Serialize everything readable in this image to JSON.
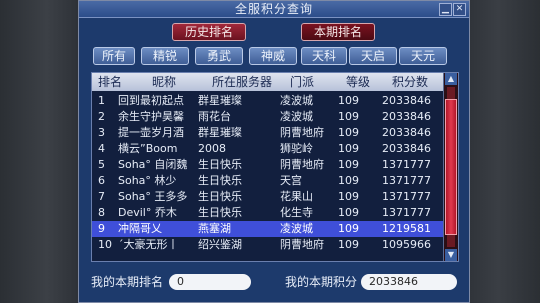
{
  "window": {
    "title": "全服积分查询"
  },
  "tabs": [
    {
      "label": "历史排名"
    },
    {
      "label": "本期排名"
    }
  ],
  "filters": [
    {
      "label": "所有"
    },
    {
      "label": "精锐"
    },
    {
      "label": "勇武"
    },
    {
      "label": "神威"
    },
    {
      "label": "天科"
    },
    {
      "label": "天启"
    },
    {
      "label": "天元"
    }
  ],
  "table": {
    "headers": [
      "排名",
      "昵称",
      "所在服务器",
      "门派",
      "等级",
      "积分数"
    ],
    "rows": [
      {
        "rank": "1",
        "name": "回到最初起点",
        "server": "群星璀璨",
        "sect": "凌波城",
        "level": "109",
        "score": "2033846"
      },
      {
        "rank": "2",
        "name": "余生守护昊馨",
        "server": "雨花台",
        "sect": "凌波城",
        "level": "109",
        "score": "2033846"
      },
      {
        "rank": "3",
        "name": "提一壶岁月酒",
        "server": "群星璀璨",
        "sect": "阴曹地府",
        "level": "109",
        "score": "2033846"
      },
      {
        "rank": "4",
        "name": "横云”Boom",
        "server": "2008",
        "sect": "狮驼岭",
        "level": "109",
        "score": "2033846"
      },
      {
        "rank": "5",
        "name": "Soha° 自闭魏",
        "server": "生日快乐",
        "sect": "阴曹地府",
        "level": "109",
        "score": "1371777"
      },
      {
        "rank": "6",
        "name": "Soha° 林少",
        "server": "生日快乐",
        "sect": "天宫",
        "level": "109",
        "score": "1371777"
      },
      {
        "rank": "7",
        "name": "Soha° 王多多",
        "server": "生日快乐",
        "sect": "花果山",
        "level": "109",
        "score": "1371777"
      },
      {
        "rank": "8",
        "name": "Devil° 乔木",
        "server": "生日快乐",
        "sect": "化生寺",
        "level": "109",
        "score": "1371777"
      },
      {
        "rank": "9",
        "name": "冲隔哥乂",
        "server": "燕塞湖",
        "sect": "凌波城",
        "level": "109",
        "score": "1219581",
        "selected": true
      },
      {
        "rank": "10",
        "name": "ˊ大豪无形丨",
        "server": "绍兴鉴湖",
        "sect": "阴曹地府",
        "level": "109",
        "score": "1095966"
      }
    ]
  },
  "footer": {
    "my_rank_label": "我的本期排名",
    "my_rank_value": "0",
    "my_score_label": "我的本期积分",
    "my_score_value": "2033846"
  }
}
